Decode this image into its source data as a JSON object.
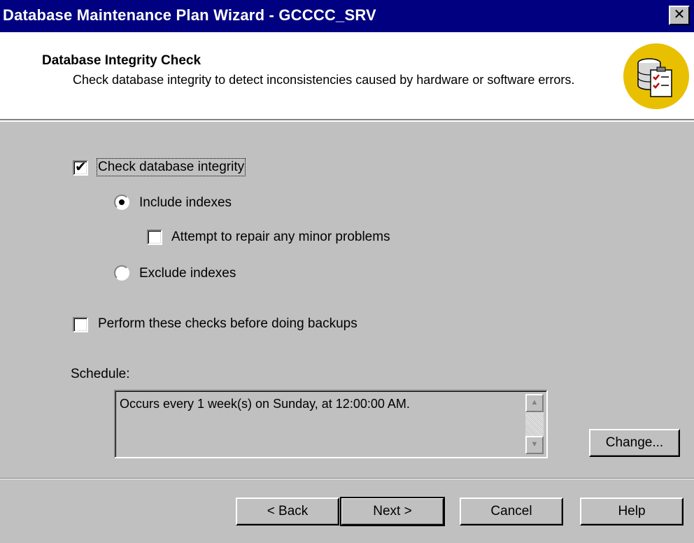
{
  "window": {
    "title": "Database Maintenance Plan Wizard - GCCCC_SRV",
    "close_glyph": "✕"
  },
  "header": {
    "title": "Database Integrity Check",
    "description": "Check database integrity to detect inconsistencies caused by hardware or software errors.",
    "icon": "database-checklist-icon"
  },
  "options": {
    "check_integrity": {
      "label": "Check database integrity",
      "checked": true
    },
    "include_indexes": {
      "label": "Include indexes",
      "selected": true
    },
    "attempt_repair": {
      "label": "Attempt to repair any minor problems",
      "checked": false
    },
    "exclude_indexes": {
      "label": "Exclude indexes",
      "selected": false
    },
    "before_backups": {
      "label": "Perform these checks before doing backups",
      "checked": false
    }
  },
  "schedule": {
    "label": "Schedule:",
    "text": "Occurs every 1 week(s) on Sunday, at 12:00:00 AM.",
    "change_label": "Change..."
  },
  "buttons": {
    "back": "< Back",
    "next": "Next >",
    "cancel": "Cancel",
    "help": "Help"
  },
  "colors": {
    "titlebar": "#000080",
    "face": "#c0c0c0",
    "icon_circle": "#e8c000"
  }
}
